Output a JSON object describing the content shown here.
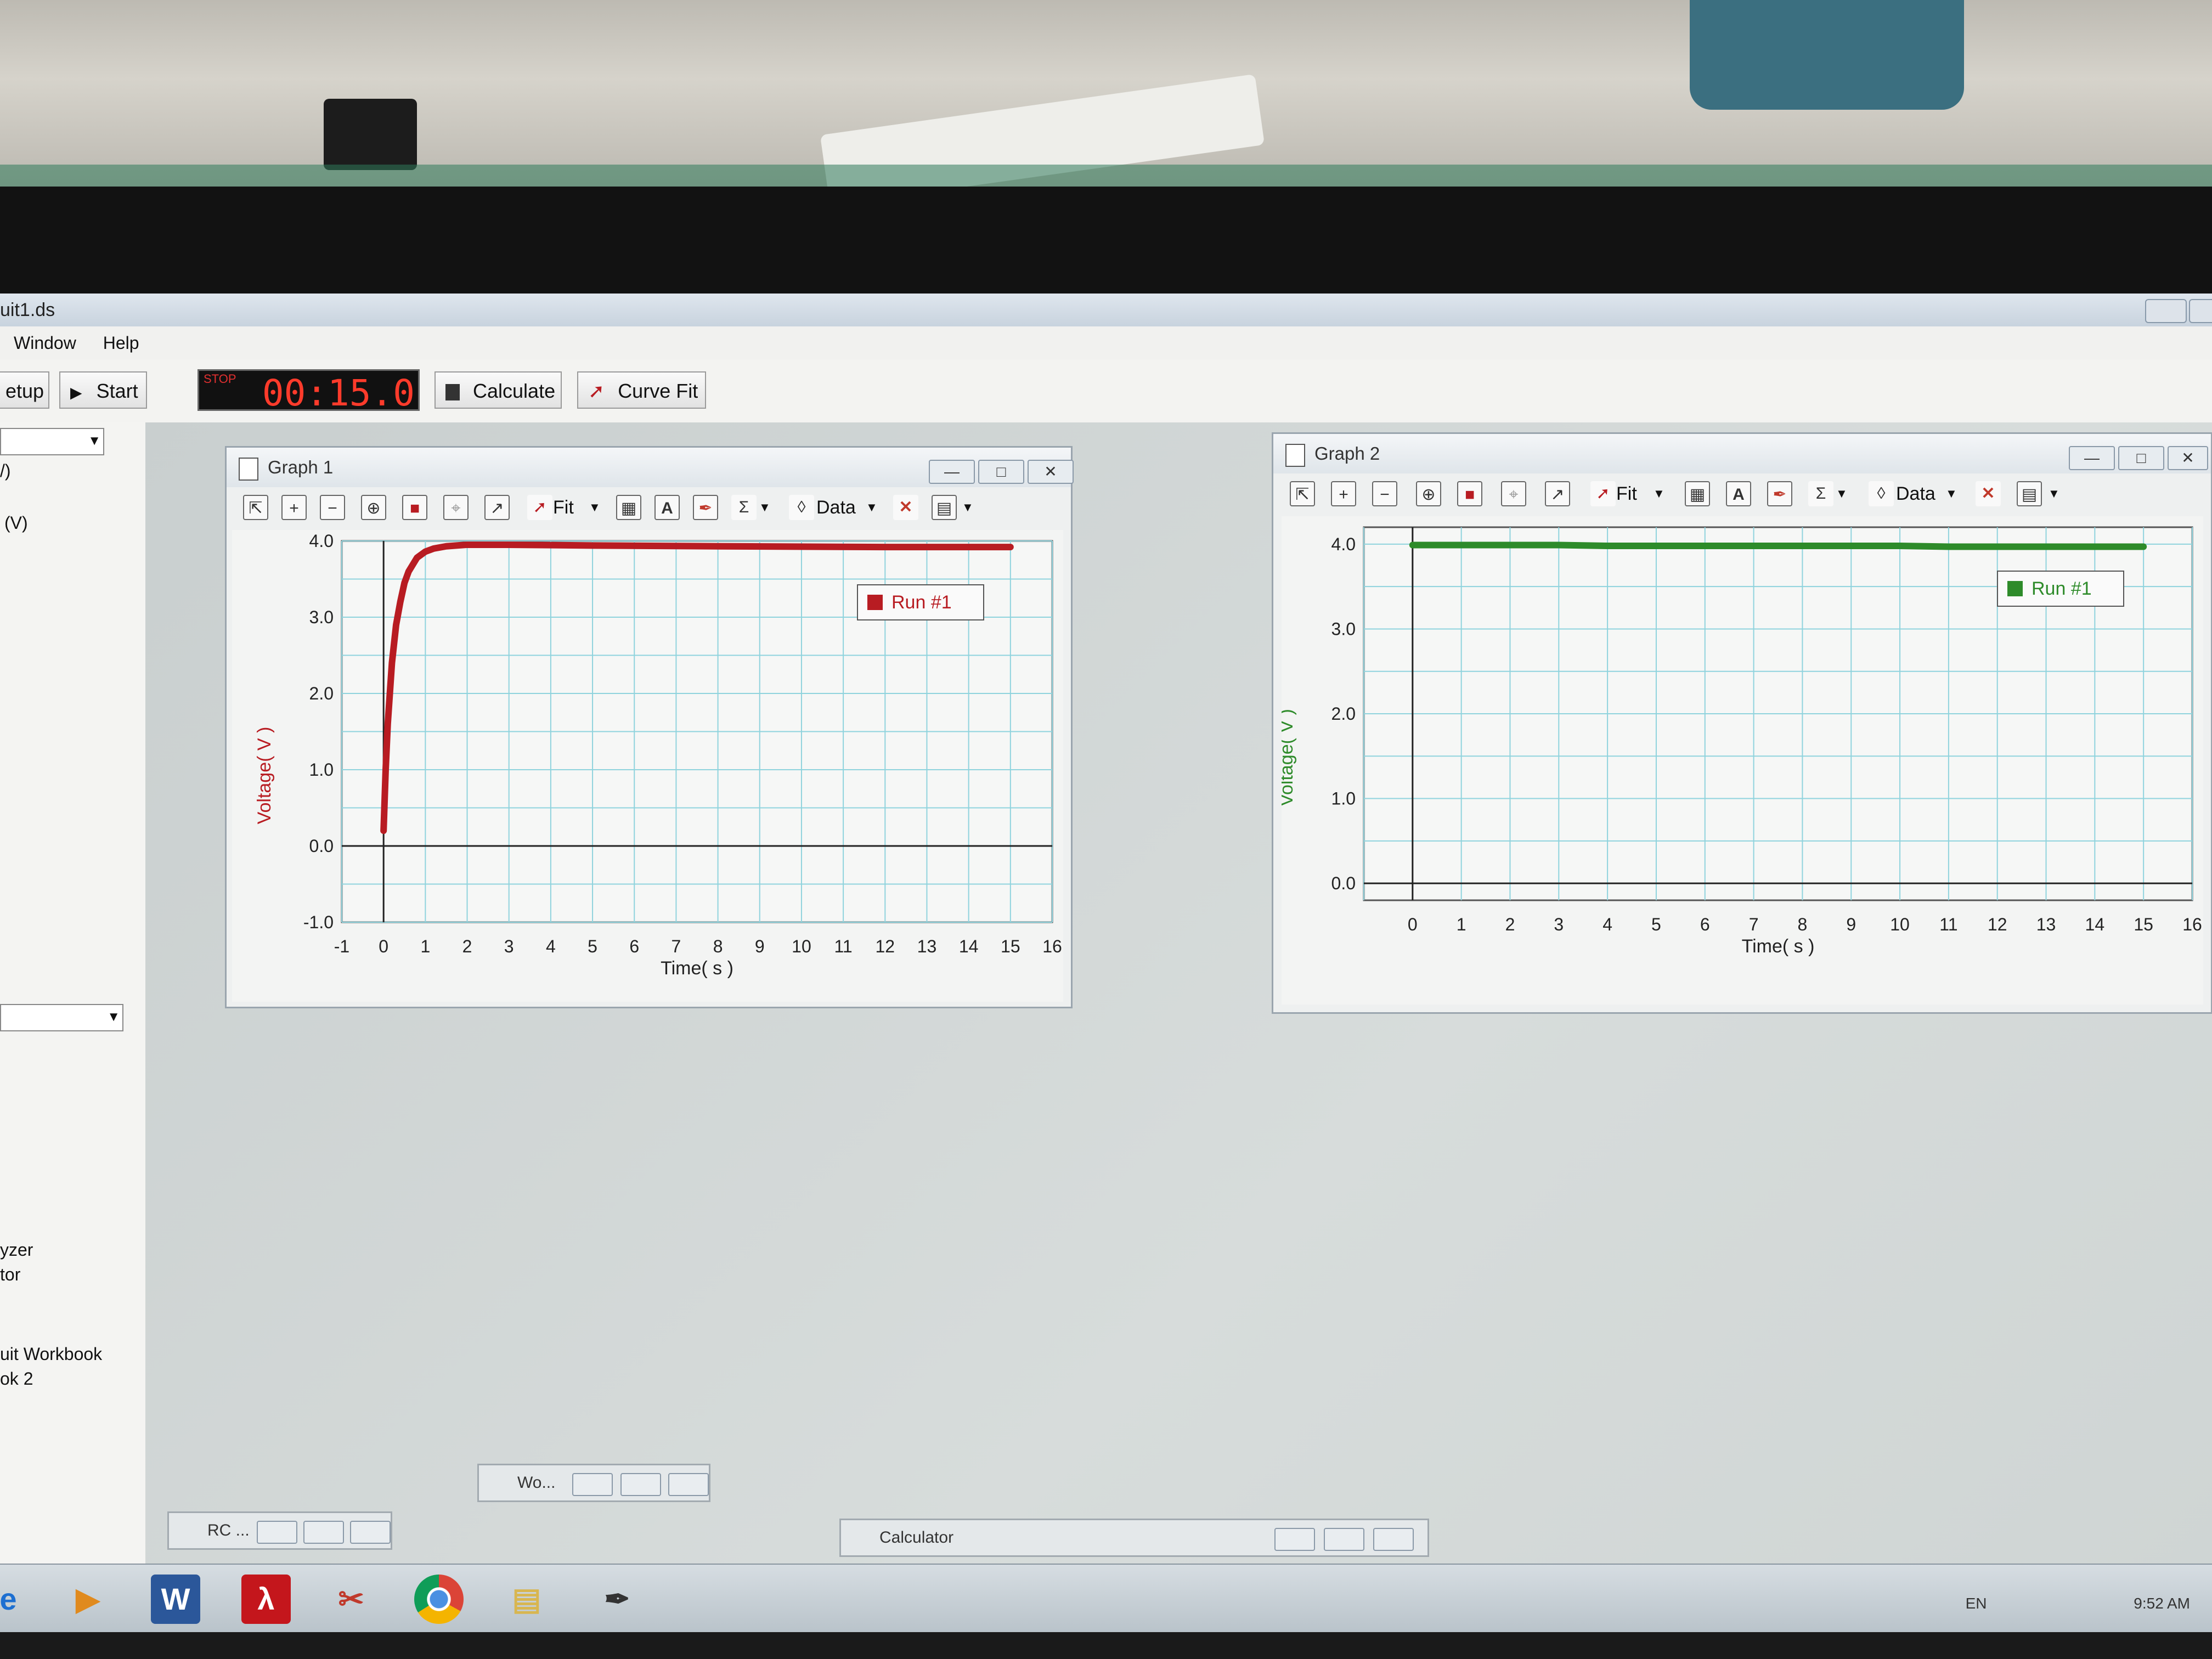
{
  "window": {
    "title": "uit1.ds"
  },
  "menu": [
    "Window",
    "Help"
  ],
  "toolbar": {
    "setup_label": "etup",
    "start_label": "Start",
    "stop_label": "STOP",
    "timer_value": "00:15.0",
    "calculate_label": "Calculate",
    "curvefit_label": "Curve Fit"
  },
  "sidebar": {
    "item_v1": "/)",
    "item_v2": "(V)",
    "line1": "yzer",
    "line2": "tor",
    "line3": "uit Workbook",
    "line4": "ok 2"
  },
  "graph_toolbar": {
    "fit": "Fit",
    "data": "Data"
  },
  "graphs": [
    {
      "title": "Graph 1",
      "legend": "Run #1",
      "ylabel": "Voltage( V )",
      "xlabel": "Time( s )",
      "color": "#b81c22",
      "yticks": [
        "4.0",
        "3.0",
        "2.0",
        "1.0",
        "0.0",
        "-1.0"
      ],
      "xticks": [
        "-1",
        "0",
        "1",
        "2",
        "3",
        "4",
        "5",
        "6",
        "7",
        "8",
        "9",
        "10",
        "11",
        "12",
        "13",
        "14",
        "15",
        "16"
      ]
    },
    {
      "title": "Graph 2",
      "legend": "Run #1",
      "ylabel": "Voltage( V )",
      "xlabel": "Time( s )",
      "color": "#2e8b2a",
      "yticks": [
        "4.0",
        "3.0",
        "2.0",
        "1.0",
        "0.0"
      ],
      "xticks": [
        "0",
        "1",
        "2",
        "3",
        "4",
        "5",
        "6",
        "7",
        "8",
        "9",
        "10",
        "11",
        "12",
        "13",
        "14",
        "15",
        "16"
      ]
    }
  ],
  "chart_data": [
    {
      "type": "line",
      "title": "Graph 1",
      "xlabel": "Time( s )",
      "ylabel": "Voltage( V )",
      "xlim": [
        -1,
        16
      ],
      "ylim": [
        -1,
        4
      ],
      "series": [
        {
          "name": "Run #1",
          "x": [
            0,
            0.05,
            0.1,
            0.2,
            0.3,
            0.4,
            0.5,
            0.6,
            0.8,
            1.0,
            1.2,
            1.5,
            2.0,
            3.0,
            5.0,
            8.0,
            12.0,
            15.0
          ],
          "y": [
            0.2,
            1.0,
            1.6,
            2.4,
            2.9,
            3.2,
            3.45,
            3.6,
            3.78,
            3.86,
            3.9,
            3.93,
            3.95,
            3.95,
            3.94,
            3.93,
            3.92,
            3.92
          ]
        }
      ]
    },
    {
      "type": "line",
      "title": "Graph 2",
      "xlabel": "Time( s )",
      "ylabel": "Voltage( V )",
      "xlim": [
        -1,
        16
      ],
      "ylim": [
        -0.2,
        4.2
      ],
      "series": [
        {
          "name": "Run #1",
          "x": [
            0,
            1,
            2,
            3,
            4,
            5,
            6,
            7,
            8,
            9,
            10,
            11,
            12,
            13,
            14,
            15
          ],
          "y": [
            3.99,
            3.99,
            3.99,
            3.99,
            3.98,
            3.98,
            3.98,
            3.98,
            3.98,
            3.98,
            3.98,
            3.97,
            3.97,
            3.97,
            3.97,
            3.97
          ]
        }
      ]
    }
  ],
  "minimized": [
    {
      "label": "Wo..."
    },
    {
      "label": "RC ..."
    },
    {
      "label": "Calculator"
    }
  ],
  "tray": {
    "lang": "EN",
    "time": "9:52 AM"
  }
}
